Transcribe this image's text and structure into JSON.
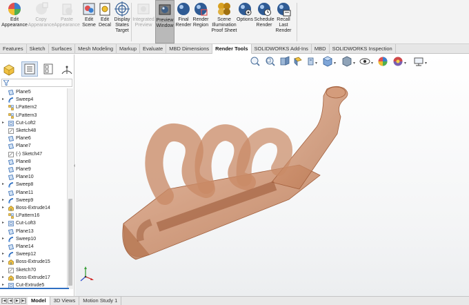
{
  "ribbon": {
    "buttons": [
      {
        "id": "edit-appearance",
        "label": "Edit\nAppearance",
        "icon": "appearance-ball-icon",
        "state": "normal"
      },
      {
        "id": "copy-appearance",
        "label": "Copy\nAppearance",
        "icon": "copy-appearance-icon",
        "state": "disabled"
      },
      {
        "id": "paste-appearance",
        "label": "Paste\nAppearance",
        "icon": "paste-appearance-icon",
        "state": "disabled"
      },
      {
        "id": "edit-scene",
        "label": "Edit\nScene",
        "icon": "scene-icon",
        "state": "normal"
      },
      {
        "id": "edit-decal",
        "label": "Edit\nDecal",
        "icon": "decal-icon",
        "state": "normal"
      },
      {
        "id": "display-states-target",
        "label": "Display\nStates\nTarget",
        "icon": "target-icon",
        "state": "normal"
      },
      {
        "id": "integrated-preview",
        "label": "Integrated\nPreview",
        "icon": "integrated-preview-icon",
        "state": "disabled"
      },
      {
        "id": "preview-window",
        "label": "Preview\nWindow",
        "icon": "preview-window-icon",
        "state": "active"
      },
      {
        "id": "final-render",
        "label": "Final\nRender",
        "icon": "render-sphere-icon",
        "state": "normal"
      },
      {
        "id": "render-region",
        "label": "Render\nRegion",
        "icon": "render-region-icon",
        "state": "normal"
      },
      {
        "id": "scene-illumination",
        "label": "Scene\nIllumination\nProof Sheet",
        "icon": "illumination-icon",
        "state": "normal"
      },
      {
        "id": "options",
        "label": "Options",
        "icon": "gear-sphere-icon",
        "state": "normal"
      },
      {
        "id": "schedule-render",
        "label": "Schedule\nRender",
        "icon": "clock-sphere-icon",
        "state": "normal"
      },
      {
        "id": "recall-last-render",
        "label": "Recall\nLast\nRender",
        "icon": "recall-render-icon",
        "state": "normal"
      }
    ]
  },
  "tabs": [
    "Features",
    "Sketch",
    "Surfaces",
    "Mesh Modeling",
    "Markup",
    "Evaluate",
    "MBD Dimensions",
    "Render Tools",
    "SOLIDWORKS Add-Ins",
    "MBD",
    "SOLIDWORKS Inspection"
  ],
  "active_tab": "Render Tools",
  "tree": [
    {
      "label": "Plane5",
      "kind": "plane",
      "expandable": false
    },
    {
      "label": "Sweep4",
      "kind": "sweep",
      "expandable": true
    },
    {
      "label": "LPattern2",
      "kind": "pattern",
      "expandable": false
    },
    {
      "label": "LPattern3",
      "kind": "pattern",
      "expandable": false
    },
    {
      "label": "Cut-Loft2",
      "kind": "cut",
      "expandable": true
    },
    {
      "label": "Sketch48",
      "kind": "sketch",
      "expandable": false
    },
    {
      "label": "Plane6",
      "kind": "plane",
      "expandable": false
    },
    {
      "label": "Plane7",
      "kind": "plane",
      "expandable": false
    },
    {
      "label": "(-) Sketch47",
      "kind": "sketch",
      "expandable": false
    },
    {
      "label": "Plane8",
      "kind": "plane",
      "expandable": false
    },
    {
      "label": "Plane9",
      "kind": "plane",
      "expandable": false
    },
    {
      "label": "Plane10",
      "kind": "plane",
      "expandable": false
    },
    {
      "label": "Sweep8",
      "kind": "sweep",
      "expandable": true
    },
    {
      "label": "Plane11",
      "kind": "plane",
      "expandable": false
    },
    {
      "label": "Sweep9",
      "kind": "sweep",
      "expandable": true
    },
    {
      "label": "Boss-Extrude14",
      "kind": "boss",
      "expandable": true
    },
    {
      "label": "LPattern16",
      "kind": "pattern",
      "expandable": false
    },
    {
      "label": "Cut-Loft3",
      "kind": "cut",
      "expandable": true
    },
    {
      "label": "Plane13",
      "kind": "plane",
      "expandable": false
    },
    {
      "label": "Sweep10",
      "kind": "sweep",
      "expandable": true
    },
    {
      "label": "Plane14",
      "kind": "plane",
      "expandable": false
    },
    {
      "label": "Sweep12",
      "kind": "sweep",
      "expandable": true
    },
    {
      "label": "Boss-Extrude15",
      "kind": "boss",
      "expandable": true
    },
    {
      "label": "Sketch70",
      "kind": "sketch",
      "expandable": false
    },
    {
      "label": "Boss-Extrude17",
      "kind": "boss",
      "expandable": true
    },
    {
      "label": "Cut-Extrude5",
      "kind": "cut",
      "expandable": true
    }
  ],
  "bottom_tabs": [
    "Model",
    "3D Views",
    "Motion Study 1"
  ],
  "active_bottom_tab": "Model",
  "colors": {
    "part_fill": "#c98a66",
    "part_edge": "#a3603d",
    "active_tab_bg": "#ffffff",
    "selection_blue": "#2f6fc2"
  }
}
